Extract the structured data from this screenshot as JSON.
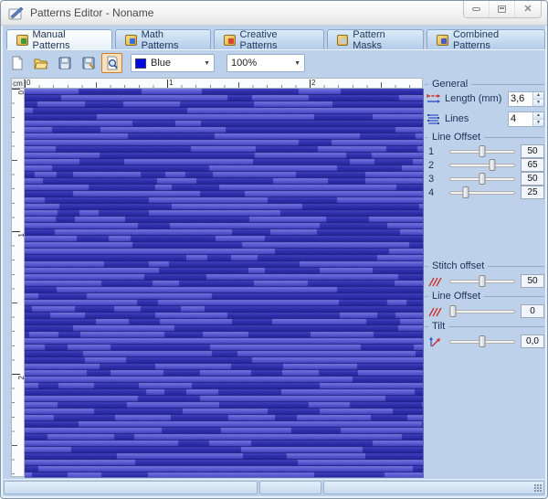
{
  "window": {
    "title": "Patterns Editor - Noname",
    "controls": {
      "minimize": "minimize",
      "maximize": "maximize",
      "close": "close"
    }
  },
  "tabs": [
    {
      "label": "Manual Patterns",
      "active": true,
      "icon_style": "--ac:#3d9a3d"
    },
    {
      "label": "Math Patterns",
      "active": false,
      "icon_style": "--ac:#3a6fd8"
    },
    {
      "label": "Creative Patterns",
      "active": false,
      "icon_style": "--ac:#d8452a"
    },
    {
      "label": "Pattern Masks",
      "active": false,
      "icon_style": "--ac:#c9ccd4"
    },
    {
      "label": "Combined Patterns",
      "active": false,
      "icon_style": "--ac:#4a58c8"
    }
  ],
  "toolbar": {
    "color_select": {
      "value": "Blue",
      "swatch": "#0008e0"
    },
    "zoom_select": {
      "value": "100%"
    }
  },
  "ruler": {
    "unit": "cm",
    "h_numbers": [
      "0",
      "1",
      "2"
    ],
    "v_numbers": [
      "0",
      "1",
      "2"
    ]
  },
  "panel": {
    "general": {
      "title": "General",
      "length_label": "Length (mm)",
      "length_value": "3,6",
      "lines_label": "Lines",
      "lines_value": "4"
    },
    "line_offset": {
      "title": "Line Offset",
      "rows": [
        {
          "label": "1",
          "value": "50",
          "pos": 50
        },
        {
          "label": "2",
          "value": "65",
          "pos": 65
        },
        {
          "label": "3",
          "value": "50",
          "pos": 50
        },
        {
          "label": "4",
          "value": "25",
          "pos": 25
        }
      ]
    },
    "stitch_offset": {
      "title": "Stitch offset",
      "value": "50",
      "pos": 50
    },
    "line_offset2": {
      "title": "Line Offset",
      "value": "0",
      "pos": 5
    },
    "tilt": {
      "title": "Tilt",
      "value": "0,0",
      "pos": 50
    }
  },
  "pattern": {
    "base": "#3030b0",
    "bar_top": "#8585ec",
    "bar_mid": "#6464dd",
    "bar_bottom": "#4444c2",
    "gap_top": "#4a4ac8",
    "gap_mid": "#3333b2",
    "gap_bottom": "#26269e",
    "separator": "rgba(14,14,96,0.55)",
    "hatch": "rgba(20,20,110,0.28)"
  },
  "statusbar": {
    "sections": [
      "",
      "",
      ""
    ]
  }
}
